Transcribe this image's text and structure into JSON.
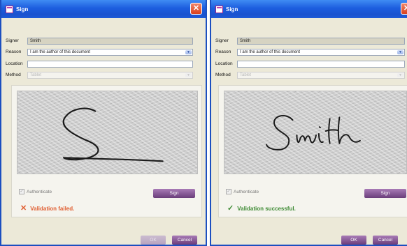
{
  "dialogs": [
    {
      "title": "Sign",
      "signer_label": "Signer",
      "signer_value": "Smith",
      "reason_label": "Reason",
      "reason_value": "I am the author of this document",
      "location_label": "Location",
      "location_value": "",
      "method_label": "Method",
      "method_value": "Tablet",
      "authenticate_label": "Authenticate",
      "sign_label": "Sign",
      "status_text": "Validation failed.",
      "ok_label": "OK",
      "cancel_label": "Cancel"
    },
    {
      "title": "Sign",
      "signer_label": "Signer",
      "signer_value": "Smith",
      "reason_label": "Reason",
      "reason_value": "I am the author of this document",
      "location_label": "Location",
      "location_value": "",
      "method_label": "Method",
      "method_value": "Tablet",
      "authenticate_label": "Authenticate",
      "sign_label": "Sign",
      "status_text": "Validation successful.",
      "ok_label": "OK",
      "cancel_label": "Cancel"
    }
  ],
  "icons": {
    "close": "close-icon",
    "fail": "cross-icon",
    "success": "checkmark-icon",
    "dropdown": "chevron-down-icon"
  },
  "colors": {
    "titlebar": "#1c5ddf",
    "button": "#7a4a8b",
    "fail": "#e05d30",
    "success": "#3d8a33"
  }
}
